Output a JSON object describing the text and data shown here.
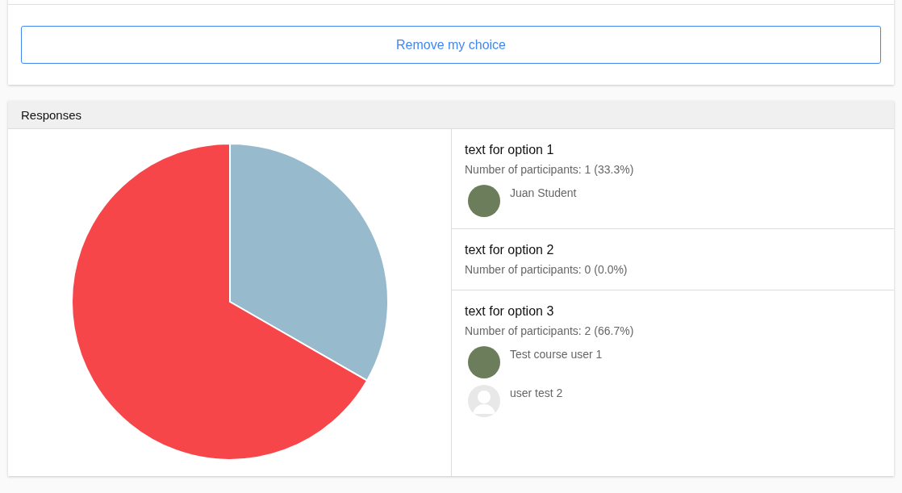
{
  "choice_card": {
    "button": "Remove my choice"
  },
  "responses": {
    "title": "Responses",
    "chart_data": {
      "type": "pie",
      "values": [
        33.3,
        0,
        66.7
      ],
      "colors": [
        "#98bacd",
        null,
        "#f7464a"
      ]
    },
    "options": [
      {
        "text": "text for option 1",
        "participants": "Number of participants: 1 (33.3%)",
        "users": [
          {
            "name": "Juan Student",
            "kind": "photo"
          }
        ]
      },
      {
        "text": "text for option 2",
        "participants": "Number of participants: 0 (0.0%)"
      },
      {
        "text": "text for option 3",
        "participants": "Number of participants: 2 (66.7%)",
        "users": [
          {
            "name": "Test course user 1",
            "kind": "photo"
          },
          {
            "name": "user test 2",
            "kind": "default"
          }
        ]
      }
    ]
  }
}
